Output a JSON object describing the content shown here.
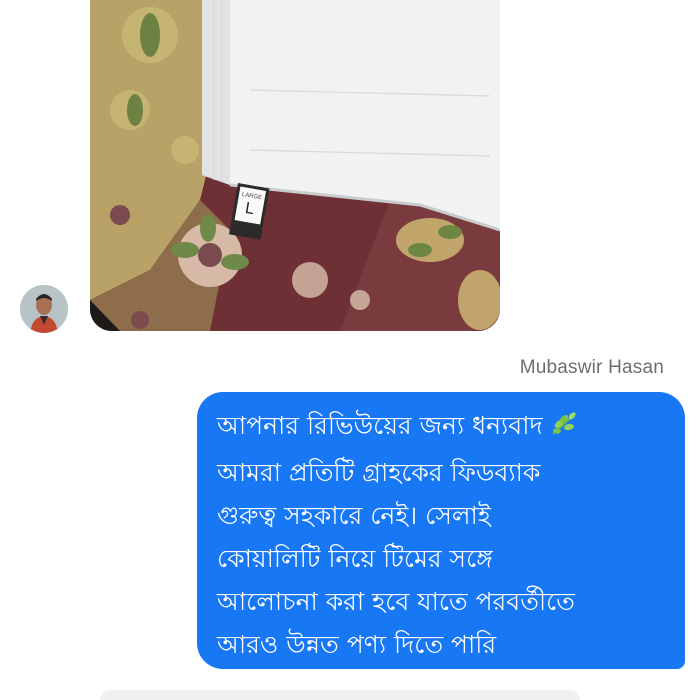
{
  "conversation": {
    "incoming_photo": {
      "tag_size": "L",
      "tag_label": "LARGE"
    },
    "sender_name": "Mubaswir Hasan",
    "outgoing_message": {
      "lines": [
        "আপনার রিভিউয়ের জন্য ধন্যবাদ",
        "আমরা প্রতিটি গ্রাহকের ফিডব্যাক",
        "গুরুত্ব সহকারে নেই। সেলাই",
        "কোয়ালিটি নিয়ে টিমের সঙ্গে",
        "আলোচনা করা হবে যাতে পরবর্তীতে",
        "আরও উন্নত পণ্য দিতে পারি"
      ],
      "emoji_icon": "herb-leaf-icon",
      "bubble_color": "#1877f2"
    }
  }
}
